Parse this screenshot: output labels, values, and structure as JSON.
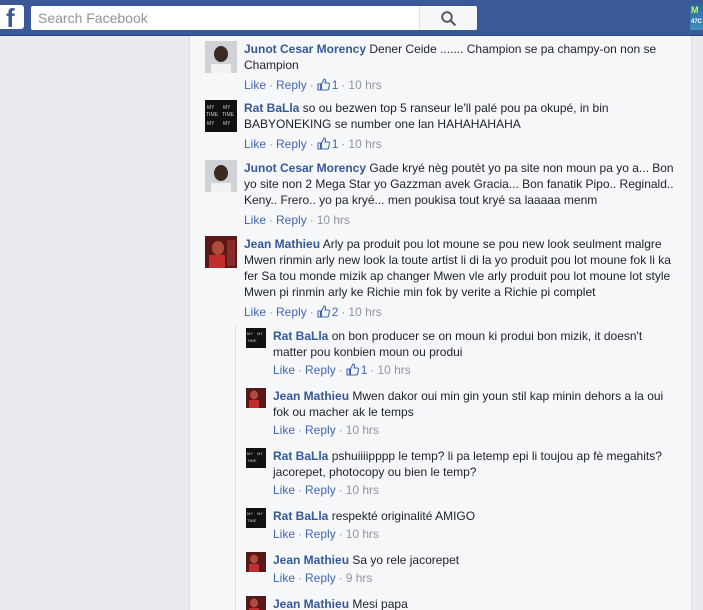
{
  "topbar": {
    "logo": "f",
    "search_placeholder": "Search Facebook",
    "corner_badge_top": "M",
    "corner_badge_bottom": "47C"
  },
  "icons": {
    "search": "search-icon",
    "like": "thumbs-up-icon"
  },
  "colors": {
    "brand": "#3b5998",
    "link": "#4267b2",
    "name": "#365899",
    "muted": "#90949c"
  },
  "comments": [
    {
      "author": "Junot Cesar Morency",
      "text": "Dener Ceide ....... Champion se pa champy-on non se Champion",
      "like": "Like",
      "reply": "Reply",
      "likes": "1",
      "time": "10 hrs"
    },
    {
      "author": "Rat BaLla",
      "text": "so ou bezwen top 5 ranseur le'll palé pou pa okupé, in bin BABYONEKING se number one lan HAHAHAHAHA",
      "like": "Like",
      "reply": "Reply",
      "likes": "1",
      "time": "10 hrs"
    },
    {
      "author": "Junot Cesar Morency",
      "text": "Gade kryé nèg poutèt yo pa site non moun pa yo a... Bon yo site non 2 Mega Star yo Gazzman avek Gracia... Bon fanatik Pipo.. Reginald.. Keny.. Frero.. yo pa kryé... men poukisa tout kryé sa laaaaa menm",
      "like": "Like",
      "reply": "Reply",
      "time": "10 hrs"
    },
    {
      "author": "Jean Mathieu",
      "text": "Arly pa produit pou lot moune se pou new look seulment malgre Mwen rinmin arly new look la toute artist li di la yo produit pou lot moune fok li ka fer Sa tou monde mizik ap changer Mwen vle arly produit pou lot moune lot style Mwen pi rinmin arly ke Richie min fok by verite a Richie pi complet",
      "like": "Like",
      "reply": "Reply",
      "likes": "2",
      "time": "10 hrs"
    }
  ],
  "replies": [
    {
      "author": "Rat BaLla",
      "text": "on bon producer se on moun ki produi bon mizik, it doesn't matter pou konbien moun ou produi",
      "like": "Like",
      "reply": "Reply",
      "likes": "1",
      "time": "10 hrs"
    },
    {
      "author": "Jean Mathieu",
      "text": "Mwen dakor oui min gin youn stil kap minin dehors a la oui fok ou macher ak le temps",
      "like": "Like",
      "reply": "Reply",
      "time": "10 hrs"
    },
    {
      "author": "Rat BaLla",
      "text": "pshuiiiipppp le temp? li pa letemp epi li toujou ap fè megahits? jacorepet, photocopy ou bien le temp?",
      "like": "Like",
      "reply": "Reply",
      "time": "10 hrs"
    },
    {
      "author": "Rat BaLla",
      "text": "respekté originalité AMIGO",
      "like": "Like",
      "reply": "Reply",
      "time": "10 hrs"
    },
    {
      "author": "Jean Mathieu",
      "text": "Sa yo rele jacorepet",
      "like": "Like",
      "reply": "Reply",
      "time": "9 hrs"
    },
    {
      "author": "Jean Mathieu",
      "text": "Mesi papa"
    }
  ]
}
